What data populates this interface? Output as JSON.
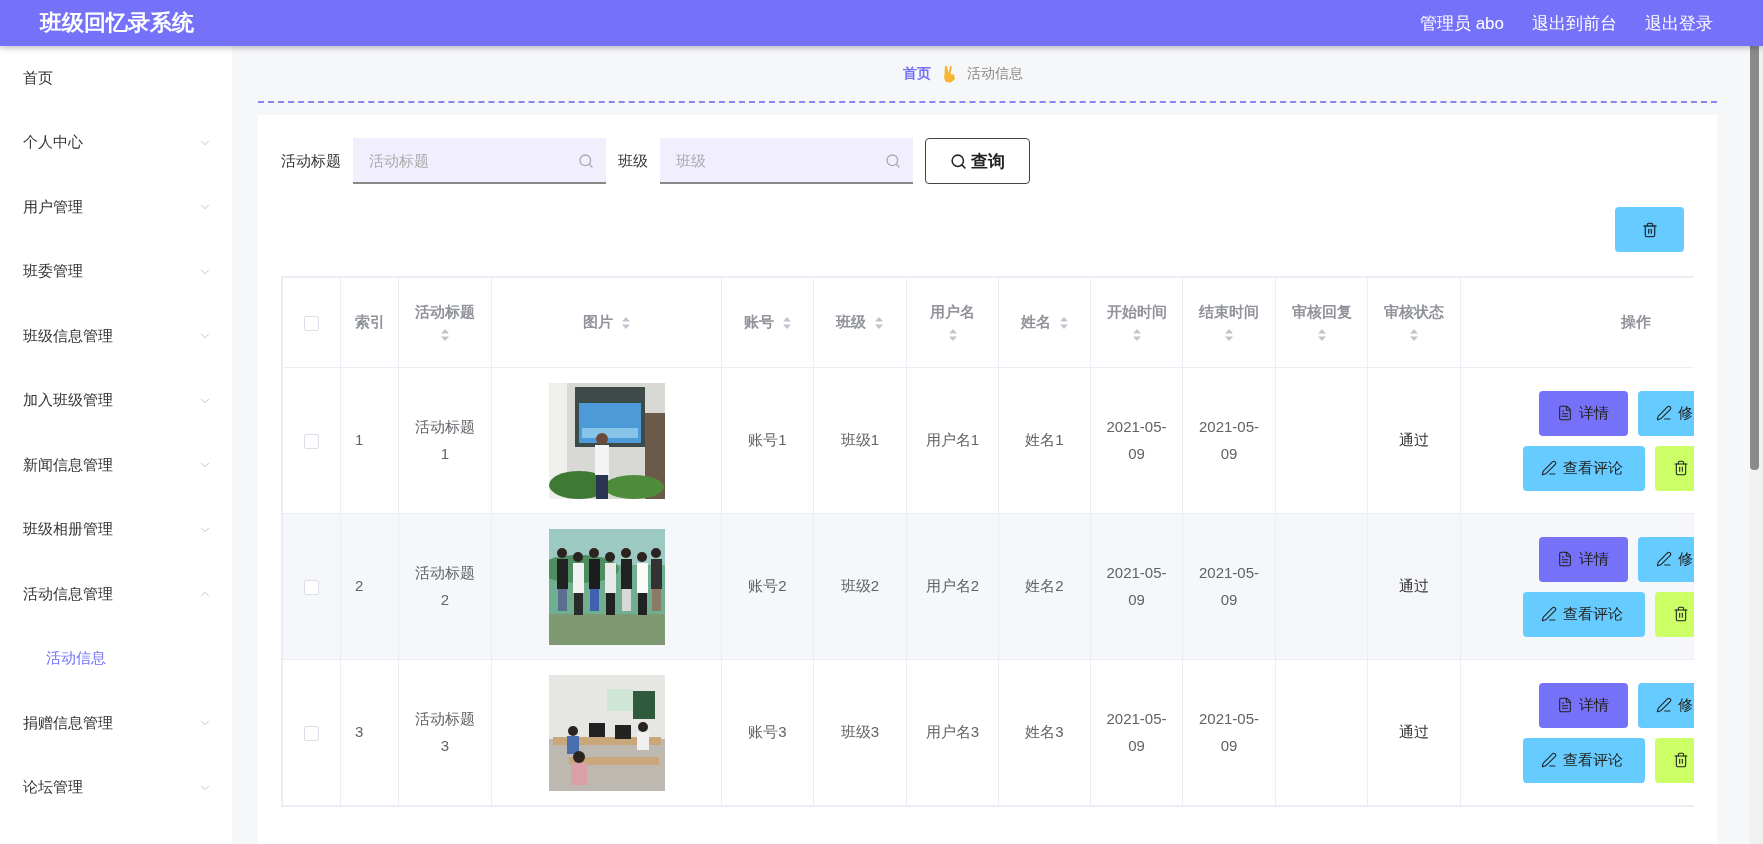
{
  "header": {
    "title": "班级回忆录系统",
    "links": [
      "管理员 abo",
      "退出到前台",
      "退出登录"
    ]
  },
  "sidebar": {
    "items": [
      {
        "label": "首页",
        "kind": "link"
      },
      {
        "label": "个人中心",
        "kind": "menu",
        "expanded": false
      },
      {
        "label": "用户管理",
        "kind": "menu",
        "expanded": false
      },
      {
        "label": "班委管理",
        "kind": "menu",
        "expanded": false
      },
      {
        "label": "班级信息管理",
        "kind": "menu",
        "expanded": false
      },
      {
        "label": "加入班级管理",
        "kind": "menu",
        "expanded": false
      },
      {
        "label": "新闻信息管理",
        "kind": "menu",
        "expanded": false
      },
      {
        "label": "班级相册管理",
        "kind": "menu",
        "expanded": false
      },
      {
        "label": "活动信息管理",
        "kind": "menu",
        "expanded": true,
        "children": [
          {
            "label": "活动信息",
            "selected": true
          }
        ]
      },
      {
        "label": "捐赠信息管理",
        "kind": "menu",
        "expanded": false
      },
      {
        "label": "论坛管理",
        "kind": "menu",
        "expanded": false
      }
    ]
  },
  "breadcrumb": [
    "首页",
    "活动信息"
  ],
  "search": {
    "fields": [
      {
        "label": "活动标题",
        "placeholder": "活动标题"
      },
      {
        "label": "班级",
        "placeholder": "班级"
      }
    ],
    "button": "查询"
  },
  "table": {
    "select_all": {
      "checked": false
    },
    "columns": [
      {
        "label": "索引",
        "sortable": false
      },
      {
        "label": "活动标题",
        "sortable": true
      },
      {
        "label": "图片",
        "sortable": true
      },
      {
        "label": "账号",
        "sortable": true
      },
      {
        "label": "班级",
        "sortable": true
      },
      {
        "label": "用户名",
        "sortable": true
      },
      {
        "label": "姓名",
        "sortable": true
      },
      {
        "label": "开始时间",
        "sortable": true
      },
      {
        "label": "结束时间",
        "sortable": true
      },
      {
        "label": "审核回复",
        "sortable": true
      },
      {
        "label": "审核状态",
        "sortable": true
      },
      {
        "label": "操作",
        "sortable": false
      }
    ],
    "rows": [
      {
        "checked": false,
        "index": "1",
        "title": "活动标题1",
        "account": "账号1",
        "class": "班级1",
        "username": "用户名1",
        "name": "姓名1",
        "start": "2021-05-09",
        "end": "2021-05-09",
        "status": "通过",
        "actions": [
          {
            "kind": "detail",
            "label": "详情"
          },
          {
            "kind": "edit",
            "label": "修"
          },
          {
            "kind": "comments",
            "label": "查看评论"
          },
          {
            "kind": "delete"
          }
        ]
      },
      {
        "checked": false,
        "index": "2",
        "title": "活动标题2",
        "account": "账号2",
        "class": "班级2",
        "username": "用户名2",
        "name": "姓名2",
        "start": "2021-05-09",
        "end": "2021-05-09",
        "status": "通过",
        "actions": [
          {
            "kind": "detail",
            "label": "详情"
          },
          {
            "kind": "edit",
            "label": "修"
          },
          {
            "kind": "comments",
            "label": "查看评论"
          },
          {
            "kind": "delete"
          }
        ]
      },
      {
        "checked": false,
        "index": "3",
        "title": "活动标题3",
        "account": "账号3",
        "class": "班级3",
        "username": "用户名3",
        "name": "姓名3",
        "start": "2021-05-09",
        "end": "2021-05-09",
        "status": "通过",
        "actions": [
          {
            "kind": "detail",
            "label": "详情"
          },
          {
            "kind": "edit",
            "label": "修"
          },
          {
            "kind": "comments",
            "label": "查看评论"
          },
          {
            "kind": "delete"
          }
        ]
      }
    ]
  }
}
